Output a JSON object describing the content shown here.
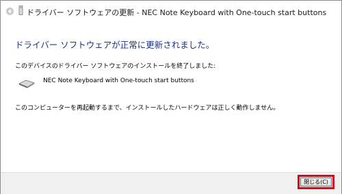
{
  "window": {
    "title": "ドライバー ソフトウェアの更新 - NEC Note Keyboard with One-touch start buttons",
    "back_icon": "back-arrow-icon",
    "device_icon": "device-icon"
  },
  "content": {
    "heading": "ドライバー ソフトウェアが正常に更新されました。",
    "completion_message": "このデバイスのドライバー ソフトウェアのインストールを終了しました:",
    "device_name": "NEC Note Keyboard with One-touch start buttons",
    "device_icon": "keyboard-icon",
    "notice": "このコンピューターを再起動するまで、インストールしたハードウェアは正しく動作しません。"
  },
  "footer": {
    "close_label": "閉じる(C)"
  },
  "colors": {
    "heading": "#1e3287",
    "highlight": "#e60012",
    "footer_bg": "#f0f0f0"
  }
}
